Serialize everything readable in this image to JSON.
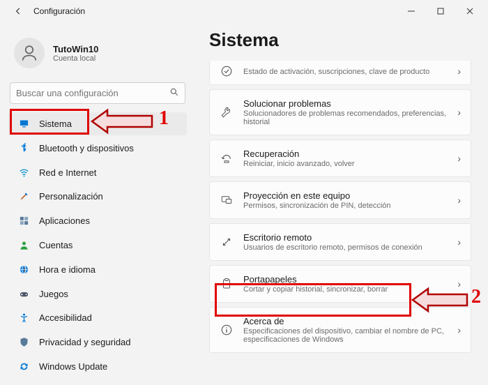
{
  "titlebar": {
    "title": "Configuración"
  },
  "profile": {
    "name": "TutoWin10",
    "sub": "Cuenta local"
  },
  "search": {
    "placeholder": "Buscar una configuración"
  },
  "nav": {
    "items": [
      {
        "label": "Sistema"
      },
      {
        "label": "Bluetooth y dispositivos"
      },
      {
        "label": "Red e Internet"
      },
      {
        "label": "Personalización"
      },
      {
        "label": "Aplicaciones"
      },
      {
        "label": "Cuentas"
      },
      {
        "label": "Hora e idioma"
      },
      {
        "label": "Juegos"
      },
      {
        "label": "Accesibilidad"
      },
      {
        "label": "Privacidad y seguridad"
      },
      {
        "label": "Windows Update"
      }
    ]
  },
  "main": {
    "title": "Sistema",
    "cards": [
      {
        "title": "",
        "sub": "Estado de activación, suscripciones, clave de producto"
      },
      {
        "title": "Solucionar problemas",
        "sub": "Solucionadores de problemas recomendados, preferencias, historial"
      },
      {
        "title": "Recuperación",
        "sub": "Reiniciar, inicio avanzado, volver"
      },
      {
        "title": "Proyección en este equipo",
        "sub": "Permisos, sincronización de PIN, detección"
      },
      {
        "title": "Escritorio remoto",
        "sub": "Usuarios de escritorio remoto, permisos de conexión"
      },
      {
        "title": "Portapapeles",
        "sub": "Cortar y copiar historial, sincronizar, borrar"
      },
      {
        "title": "Acerca de",
        "sub": "Especificaciones del dispositivo, cambiar el nombre de PC, especificaciones de Windows"
      }
    ]
  },
  "annotations": {
    "num1": "1",
    "num2": "2"
  }
}
